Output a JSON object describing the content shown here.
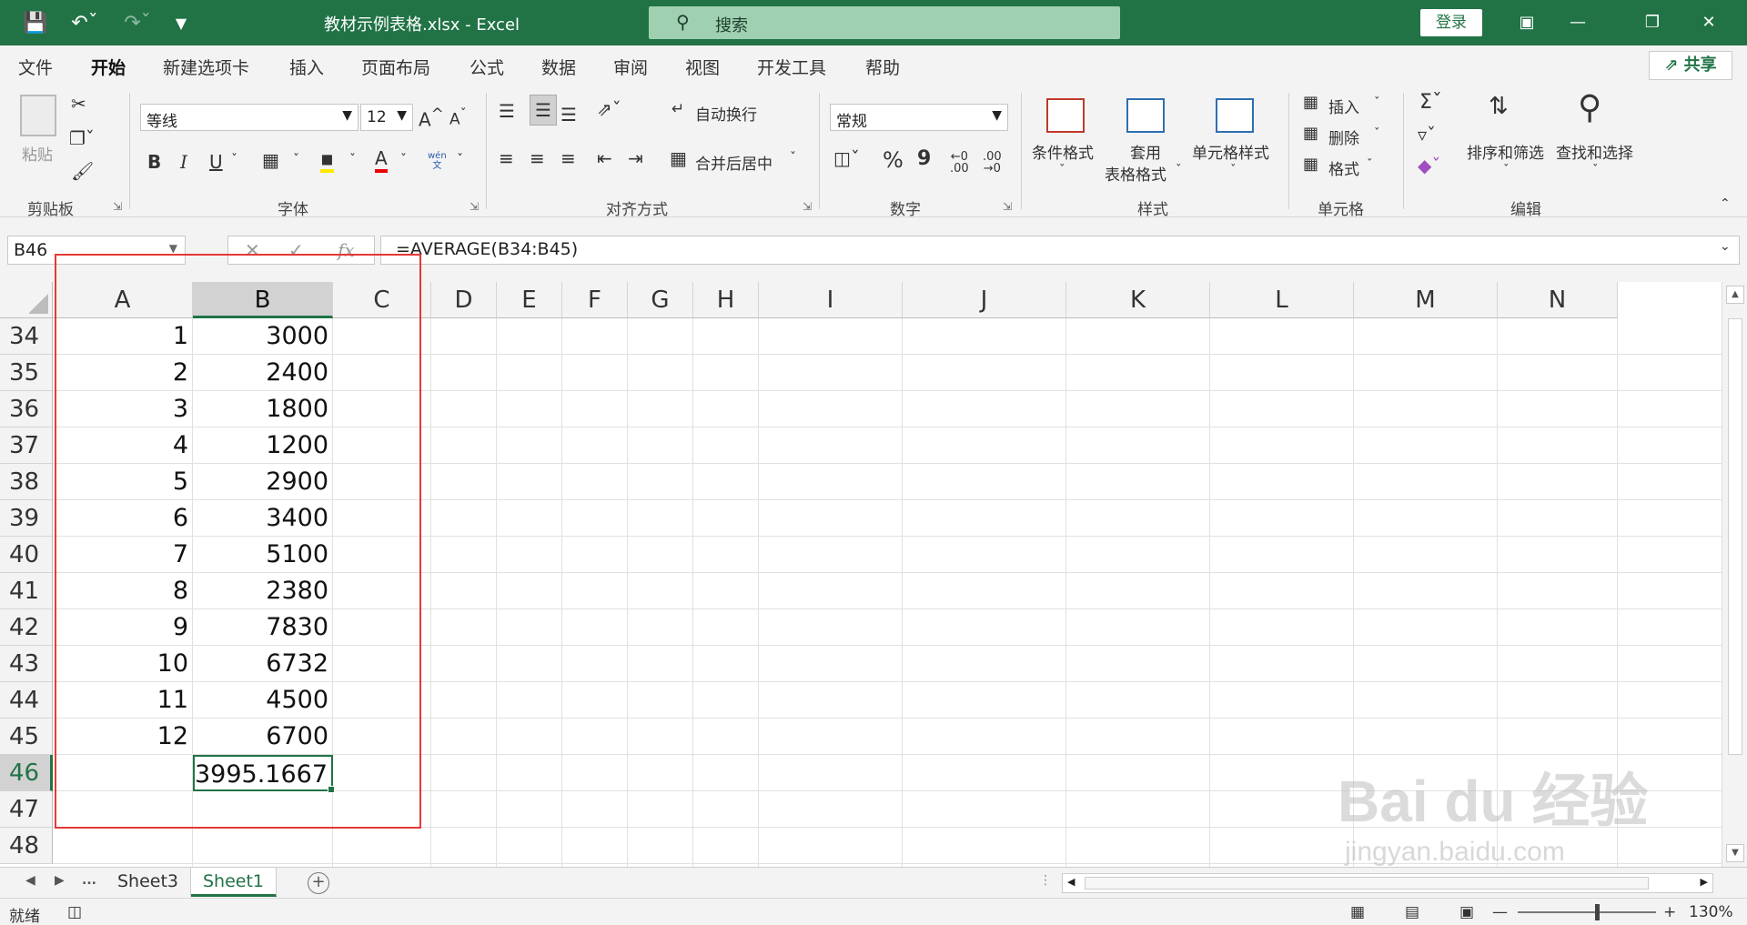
{
  "window": {
    "title": "教材示例表格.xlsx  -  Excel",
    "search_placeholder": "搜索",
    "login": "登录"
  },
  "menu_tabs": [
    "文件",
    "开始",
    "新建选项卡",
    "插入",
    "页面布局",
    "公式",
    "数据",
    "审阅",
    "视图",
    "开发工具",
    "帮助"
  ],
  "active_tab": "开始",
  "share": "共享",
  "ribbon": {
    "clipboard": {
      "paste": "粘贴",
      "label": "剪贴板"
    },
    "font": {
      "name": "等线",
      "size": "12",
      "label": "字体",
      "phonetic_top": "wén",
      "phonetic_bottom": "文",
      "bold": "B",
      "italic": "I",
      "underline": "U",
      "grow": "A",
      "shrink": "A"
    },
    "alignment": {
      "wrap": "自动换行",
      "merge": "合并后居中",
      "label": "对齐方式"
    },
    "number": {
      "format": "常规",
      "label": "数字",
      "percent": "%",
      "comma": "9"
    },
    "styles": {
      "conditional": "条件格式",
      "table_line1": "套用",
      "table_line2": "表格格式",
      "cell_styles": "单元格样式",
      "label": "样式"
    },
    "cells": {
      "insert": "插入",
      "delete": "删除",
      "format": "格式",
      "label": "单元格"
    },
    "editing": {
      "sort": "排序和筛选",
      "find": "查找和选择",
      "label": "编辑"
    }
  },
  "formula_bar": {
    "name_box": "B46",
    "fx": "fx",
    "formula": "=AVERAGE(B34:B45)"
  },
  "columns": [
    "A",
    "B",
    "C",
    "D",
    "E",
    "F",
    "G",
    "H",
    "I",
    "J",
    "K",
    "L",
    "M",
    "N"
  ],
  "selected_column": "B",
  "rows": [
    {
      "num": "34",
      "a": "1",
      "b": "3000"
    },
    {
      "num": "35",
      "a": "2",
      "b": "2400"
    },
    {
      "num": "36",
      "a": "3",
      "b": "1800"
    },
    {
      "num": "37",
      "a": "4",
      "b": "1200"
    },
    {
      "num": "38",
      "a": "5",
      "b": "2900"
    },
    {
      "num": "39",
      "a": "6",
      "b": "3400"
    },
    {
      "num": "40",
      "a": "7",
      "b": "5100"
    },
    {
      "num": "41",
      "a": "8",
      "b": "2380"
    },
    {
      "num": "42",
      "a": "9",
      "b": "7830"
    },
    {
      "num": "43",
      "a": "10",
      "b": "6732"
    },
    {
      "num": "44",
      "a": "11",
      "b": "4500"
    },
    {
      "num": "45",
      "a": "12",
      "b": "6700"
    },
    {
      "num": "46",
      "a": "",
      "b": "3995.1667"
    },
    {
      "num": "47",
      "a": "",
      "b": ""
    },
    {
      "num": "48",
      "a": "",
      "b": ""
    }
  ],
  "selected_row": "46",
  "sheets": [
    "Sheet3",
    "Sheet1"
  ],
  "active_sheet": "Sheet1",
  "sheet_more": "...",
  "status": {
    "ready": "就绪",
    "zoom": "130%"
  },
  "watermark": {
    "line1": "Bai du 经验",
    "line2": "jingyan.baidu.com"
  },
  "colors": {
    "accent": "#217346",
    "highlight_box": "#e53935"
  }
}
